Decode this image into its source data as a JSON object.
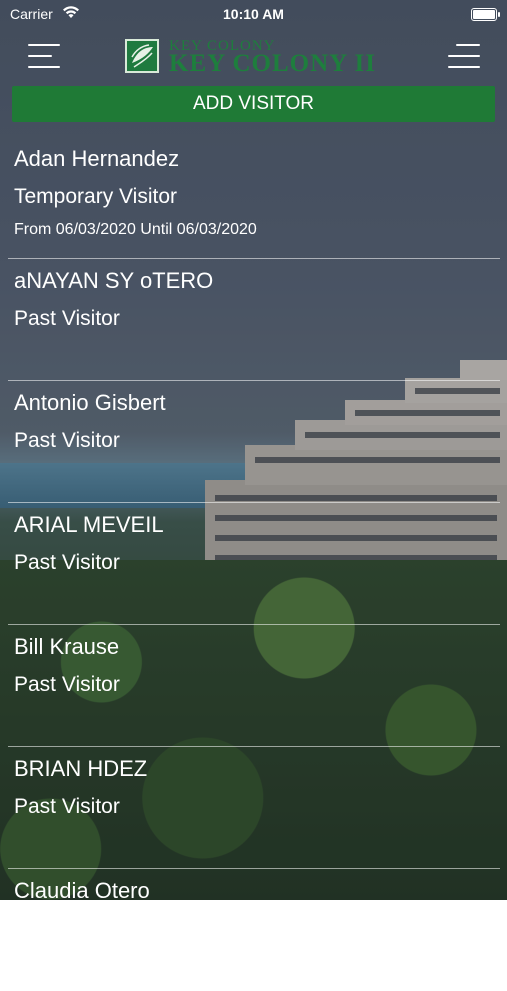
{
  "status_bar": {
    "carrier": "Carrier",
    "time": "10:10 AM"
  },
  "header": {
    "logo_line1": "KEY COLONY",
    "logo_line2": "KEY COLONY II"
  },
  "add_visitor_label": "ADD VISITOR",
  "visitors": [
    {
      "name": "Adan Hernandez",
      "type": "Temporary Visitor",
      "dates": "From 06/03/2020 Until 06/03/2020"
    },
    {
      "name": "aNAYAN SY oTERO",
      "type": "Past Visitor",
      "dates": ""
    },
    {
      "name": "Antonio Gisbert",
      "type": "Past Visitor",
      "dates": ""
    },
    {
      "name": "ARIAL MEVEIL",
      "type": "Past Visitor",
      "dates": ""
    },
    {
      "name": "Bill Krause",
      "type": "Past Visitor",
      "dates": ""
    },
    {
      "name": "BRIAN HDEZ",
      "type": "Past Visitor",
      "dates": ""
    },
    {
      "name": "Claudia Otero",
      "type": "",
      "dates": ""
    }
  ]
}
